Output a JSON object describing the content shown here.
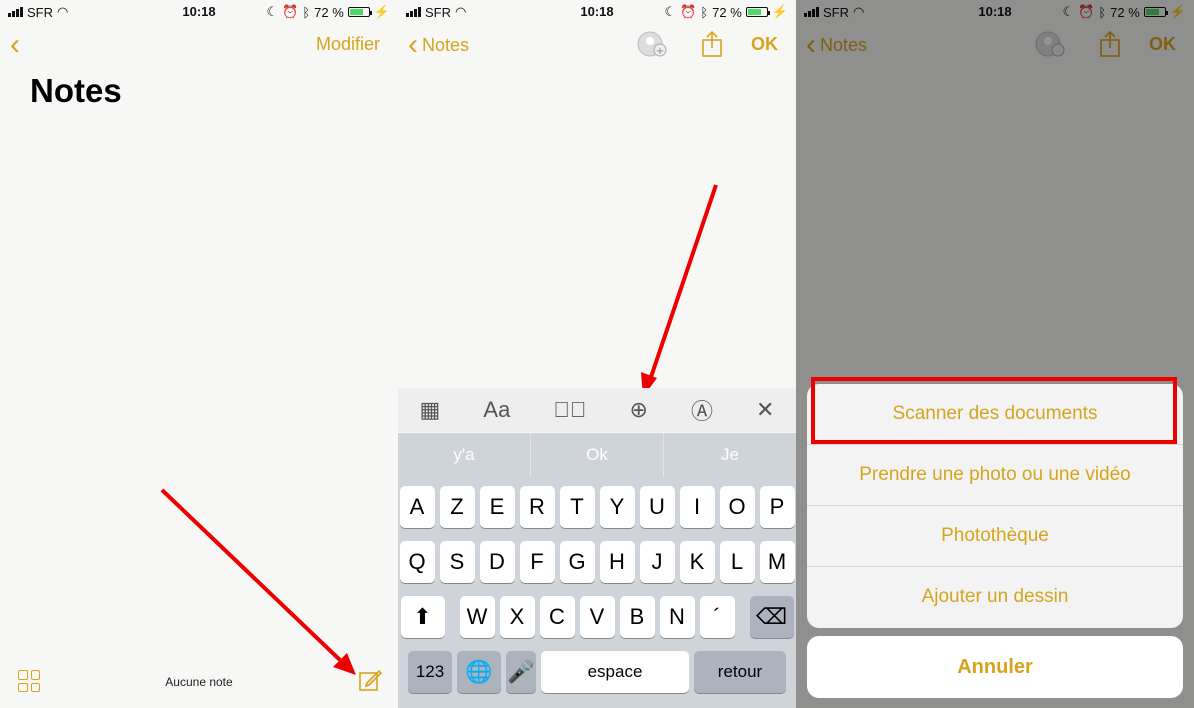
{
  "status": {
    "carrier": "SFR",
    "time": "10:18",
    "battery": "72 %",
    "battery_level": 0.72
  },
  "panel1": {
    "modifier": "Modifier",
    "title": "Notes",
    "aucune": "Aucune note"
  },
  "panel2": {
    "back": "Notes",
    "ok": "OK",
    "toolbar": {
      "format": "Aa"
    },
    "suggestions": [
      "y'a",
      "Ok",
      "Je"
    ],
    "row1": [
      "A",
      "Z",
      "E",
      "R",
      "T",
      "Y",
      "U",
      "I",
      "O",
      "P"
    ],
    "row2": [
      "Q",
      "S",
      "D",
      "F",
      "G",
      "H",
      "J",
      "K",
      "L",
      "M"
    ],
    "row3": [
      "W",
      "X",
      "C",
      "V",
      "B",
      "N",
      "´"
    ],
    "num": "123",
    "space": "espace",
    "return": "retour"
  },
  "panel3": {
    "back": "Notes",
    "ok": "OK",
    "options": [
      "Scanner des documents",
      "Prendre une photo ou une vidéo",
      "Photothèque",
      "Ajouter un dessin"
    ],
    "cancel": "Annuler"
  },
  "colors": {
    "accent": "#d6a41c",
    "highlight": "#e00000"
  }
}
